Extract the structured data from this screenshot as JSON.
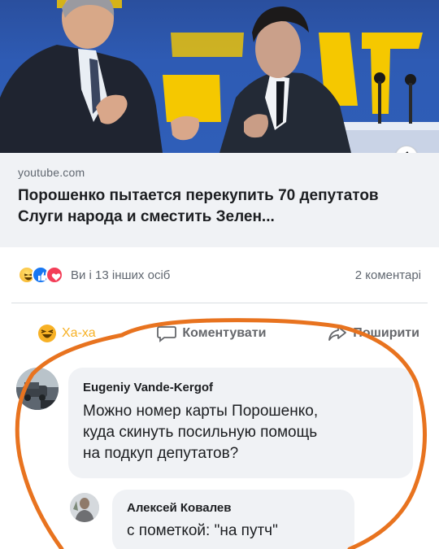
{
  "post": {
    "link": {
      "domain": "youtube.com",
      "title": "Порошенко пытается перекупить 70 депутатов Слуги народа и сместить Зелен...",
      "info_icon": "info-icon",
      "info_glyph": "i"
    },
    "reactions": {
      "icons": [
        "haha-reaction-icon",
        "like-reaction-icon",
        "love-reaction-icon"
      ],
      "summary": "Ви і 13 інших осіб",
      "comments": "2 коментарі"
    },
    "actions": {
      "haha": "Ха-ха",
      "comment": "Коментувати",
      "share": "Поширити"
    }
  },
  "comments": [
    {
      "author": "Eugeniy Vande-Kergof",
      "lines": [
        "Можно номер карты Порошенко,",
        "куда скинуть посильную помощь",
        "на подкуп депутатов?"
      ]
    },
    {
      "author": "Алексей Ковалев",
      "lines": [
        "с пометкой: \"на путч\""
      ]
    }
  ],
  "colors": {
    "annotation": "#e8731f",
    "link_bg": "#f0f2f5",
    "muted_text": "#606770",
    "haha_yellow": "#f7b125",
    "like_blue": "#1877f2",
    "love_red": "#f33e58"
  }
}
